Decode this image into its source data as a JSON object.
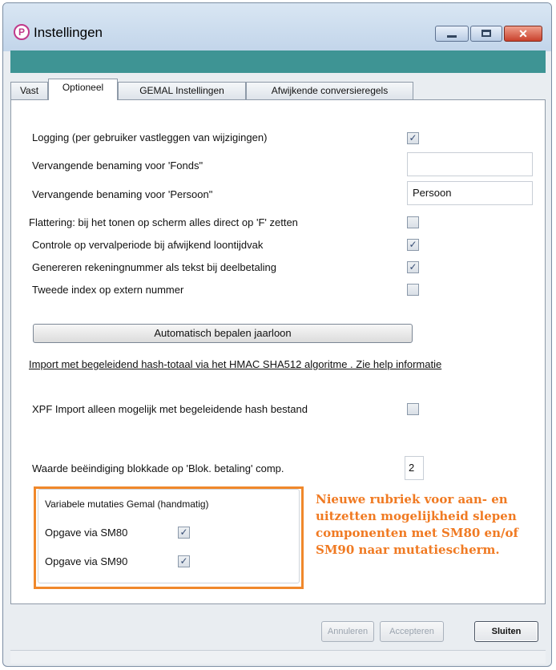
{
  "window": {
    "title": "Instellingen",
    "app_icon": "P"
  },
  "tabs": [
    {
      "label": "Vast"
    },
    {
      "label": "Optioneel"
    },
    {
      "label": "GEMAL Instellingen"
    },
    {
      "label": "Afwijkende conversieregels"
    }
  ],
  "settings": {
    "logging": {
      "label": "Logging (per gebruiker vastleggen van wijzigingen)",
      "checked": "✓"
    },
    "fonds": {
      "label": "Vervangende  benaming voor 'Fonds\"",
      "value": ""
    },
    "persoon": {
      "label": "Vervangende  benaming voor 'Persoon\"",
      "value": "Persoon"
    },
    "flattering": {
      "label": "Flattering: bij het tonen op scherm alles direct op  'F' zetten",
      "checked": ""
    },
    "controle": {
      "label": "Controle op vervalperiode bij afwijkend loontijdvak",
      "checked": "✓"
    },
    "genereren": {
      "label": "Genereren rekeningnummer als tekst bij deelbetaling",
      "checked": "✓"
    },
    "tweede_index": {
      "label": "Tweede index op extern nummer",
      "checked": ""
    },
    "auto_button": "Automatisch bepalen jaarloon",
    "import_link": "Import met begeleidend hash-totaal via het HMAC SHA512 algoritme .  Zie help informatie",
    "xpf": {
      "label": "XPF Import alleen mogelijk met begeleidende hash bestand",
      "checked": ""
    },
    "blokkade": {
      "label": "Waarde beëindiging blokkade op 'Blok. betaling' comp.",
      "value": "2"
    }
  },
  "group": {
    "title": "Variabele mutaties Gemal  (handmatig)",
    "sm80": {
      "label": "Opgave via SM80",
      "checked": "✓"
    },
    "sm90": {
      "label": "Opgave via SM90",
      "checked": "✓"
    }
  },
  "annotation": {
    "line1": "Nieuwe rubriek voor aan- en",
    "line2": "uitzetten mogelijkheid slepen",
    "line3": "componenten met SM80 en/of",
    "line4": "SM90 naar mutatiescherm."
  },
  "footer": {
    "annuleren": "Annuleren",
    "accepteren": "Accepteren",
    "sluiten": "Sluiten"
  },
  "colors": {
    "teal_bar": "#3e9494",
    "annotation": "#f07a22",
    "highlight_border": "#f0882b"
  }
}
